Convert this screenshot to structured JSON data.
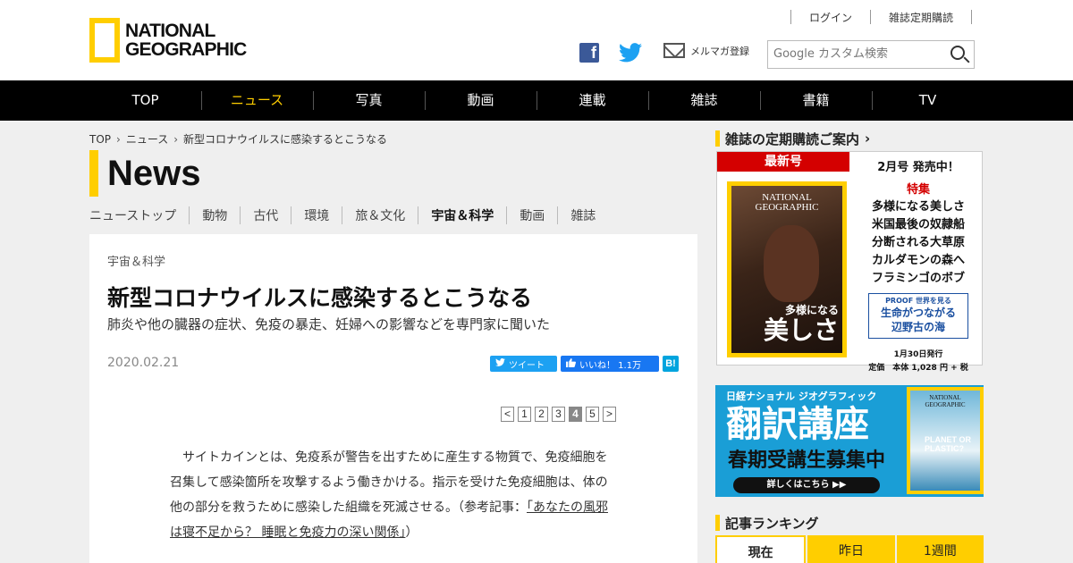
{
  "header": {
    "logo": [
      "NATIONAL",
      "GEOGRAPHIC"
    ],
    "login": "ログイン",
    "subscribe_link": "雑誌定期購読",
    "social": {
      "facebook": "f",
      "mail_label": "メルマガ登録"
    },
    "search_placeholder": "Google カスタム検索"
  },
  "nav": [
    "TOP",
    "ニュース",
    "写真",
    "動画",
    "連載",
    "雑誌",
    "書籍",
    "TV"
  ],
  "breadcrumb": [
    "TOP",
    "ニュース",
    "新型コロナウイルスに感染するとこうなる"
  ],
  "section_title": "News",
  "category_tabs": [
    "ニューストップ",
    "動物",
    "古代",
    "環境",
    "旅＆文化",
    "宇宙＆科学",
    "動画",
    "雑誌"
  ],
  "article": {
    "category": "宇宙＆科学",
    "title": "新型コロナウイルスに感染するとこうなる",
    "subtitle": "肺炎や他の臓器の症状、免疫の暴走、妊婦への影響などを専門家に聞いた",
    "date": "2020.02.21",
    "share": {
      "tweet": "ツイート",
      "like": "いいね！ 1.1万",
      "hatena": "B!"
    },
    "pager": [
      "<",
      "1",
      "2",
      "3",
      "4",
      "5",
      ">"
    ],
    "pager_current": "4",
    "body_before_link": "サイトカインとは、免疫系が警告を出すために産生する物質で、免疫細胞を召集して感染箇所を攻撃するよう働きかける。指示を受けた免疫細胞は、体の他の部分を救うために感染した組織を死滅させる。（参考記事：",
    "body_link": "「あなたの風邪は寝不足から？ 睡眠と免疫力の深い関係」",
    "body_after_link": "）"
  },
  "sidebar": {
    "magazine_heading": "雑誌の定期購読ご案内",
    "latest_label": "最新号",
    "cover": {
      "ng": [
        "NATIONAL",
        "GEOGRAPHIC"
      ],
      "small": "多様になる",
      "big": "美しさ"
    },
    "issue": "2月号 発売中！",
    "feature_label": "特集",
    "features": [
      "多様になる美しさ",
      "米国最後の奴隷船",
      "分断される大草原",
      "カルダモンの森へ",
      "フラミンゴのボブ"
    ],
    "proof_label": "PROOF 世界を見る",
    "proof_title": [
      "生命がつながる",
      "辺野古の海"
    ],
    "issued": "1月30日発行",
    "price": "定価　本体 1,028 円 + 税",
    "course": {
      "top": "日経ナショナル ジオグラフィック",
      "title": "翻訳講座",
      "subtitle": "春期受講生募集中",
      "button": "詳しくはこちら ▶▶",
      "cover_ng": [
        "NATIONAL",
        "GEOGRAPHIC"
      ],
      "cover_text": [
        "PLANET OR",
        "PLASTIC?"
      ]
    },
    "ranking_heading": "記事ランキング",
    "ranking_tabs": [
      "現在",
      "昨日",
      "1週間"
    ]
  },
  "colors": {
    "accent": "#ffce00",
    "nav_bg": "#000000",
    "red": "#d40000",
    "course_blue": "#1a9ed6"
  }
}
